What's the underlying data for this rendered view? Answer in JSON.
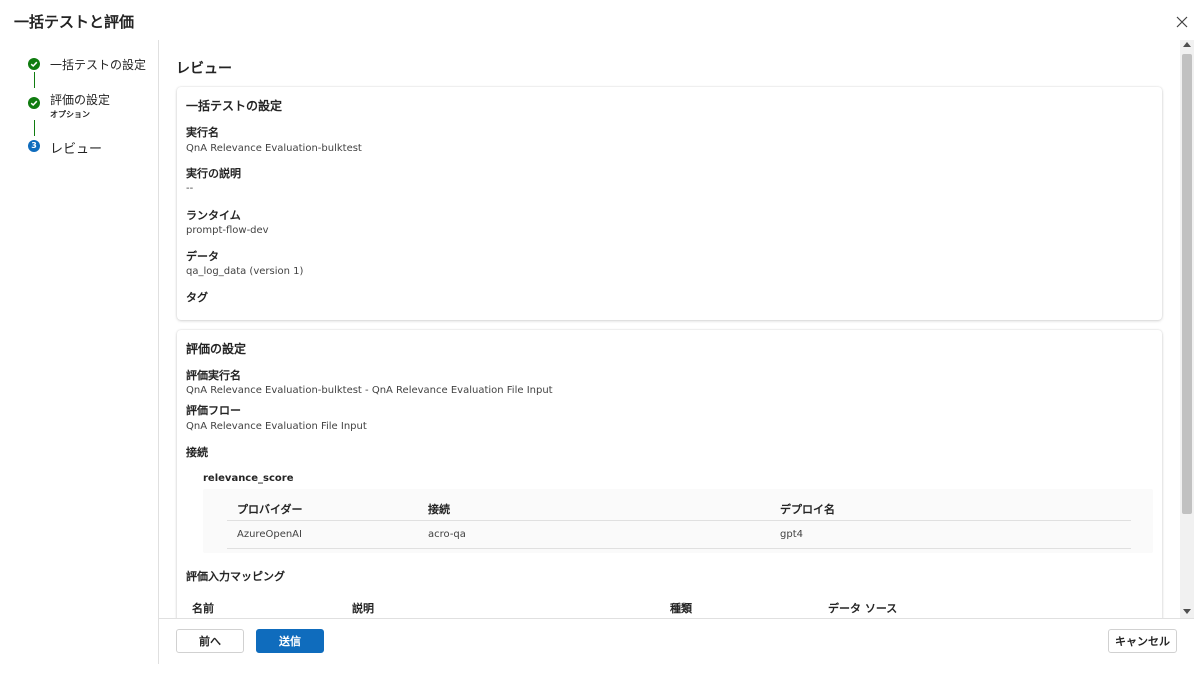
{
  "dialog": {
    "title": "一括テストと評価",
    "close_icon": "close-icon"
  },
  "stepper": {
    "steps": [
      {
        "label": "一括テストの設定",
        "status": "done"
      },
      {
        "label": "評価の設定",
        "sublabel": "オプション",
        "status": "done"
      },
      {
        "label": "レビュー",
        "number": "3",
        "status": "current"
      }
    ],
    "colors": {
      "done": "#107c10",
      "current": "#0f6cbd"
    }
  },
  "main": {
    "title": "レビュー",
    "bulk_test": {
      "title": "一括テストの設定",
      "run_name_label": "実行名",
      "run_name_value": "QnA Relevance Evaluation-bulktest",
      "description_label": "実行の説明",
      "description_value": "--",
      "runtime_label": "ランタイム",
      "runtime_value": "prompt-flow-dev",
      "data_label": "データ",
      "data_value": "qa_log_data (version 1)",
      "tags_label": "タグ"
    },
    "evaluation": {
      "title": "評価の設定",
      "eval_run_name_label": "評価実行名",
      "eval_run_name_value": "QnA Relevance Evaluation-bulktest - QnA Relevance Evaluation File Input",
      "eval_flow_label": "評価フロー",
      "eval_flow_value": "QnA Relevance Evaluation File Input",
      "connection_label": "接続",
      "connection_group": "relevance_score",
      "connection_table": {
        "headers": [
          "プロバイダー",
          "接続",
          "デプロイ名"
        ],
        "rows": [
          [
            "AzureOpenAI",
            "acro-qa",
            "gpt4"
          ]
        ]
      },
      "input_mapping_title": "評価入力マッピング",
      "input_mapping_headers": [
        "名前",
        "説明",
        "種類",
        "データ ソース"
      ]
    }
  },
  "footer": {
    "back_label": "前へ",
    "submit_label": "送信",
    "cancel_label": "キャンセル"
  },
  "colors": {
    "primary": "#0f6cbd",
    "success": "#107c10"
  }
}
